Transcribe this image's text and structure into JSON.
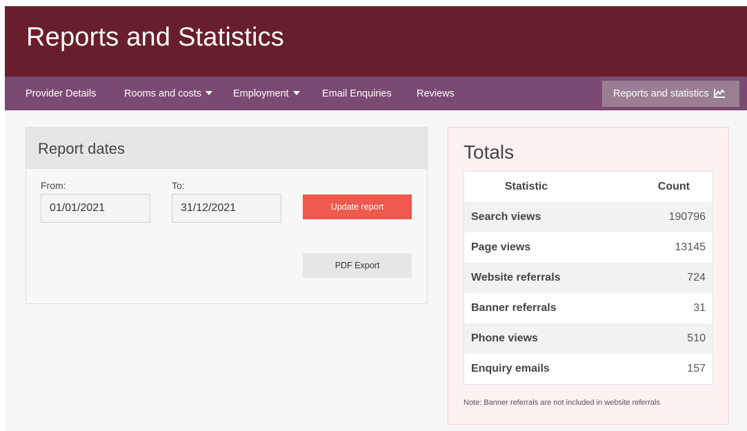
{
  "header": {
    "title": "Reports and Statistics"
  },
  "nav": {
    "provider_details": "Provider Details",
    "rooms_and_costs": "Rooms and costs",
    "employment": "Employment",
    "email_enquiries": "Email Enquiries",
    "reviews": "Reviews",
    "reports_and_statistics": "Reports and statistics"
  },
  "report_dates": {
    "heading": "Report dates",
    "from_label": "From:",
    "from_value": "01/01/2021",
    "to_label": "To:",
    "to_value": "31/12/2021",
    "update_button": "Update report",
    "pdf_button": "PDF Export"
  },
  "totals": {
    "title": "Totals",
    "columns": {
      "statistic": "Statistic",
      "count": "Count"
    },
    "rows": [
      {
        "label": "Search views",
        "count": "190796"
      },
      {
        "label": "Page views",
        "count": "13145"
      },
      {
        "label": "Website referrals",
        "count": "724"
      },
      {
        "label": "Banner referrals",
        "count": "31"
      },
      {
        "label": "Phone views",
        "count": "510"
      },
      {
        "label": "Enquiry emails",
        "count": "157"
      }
    ],
    "note": "Note: Banner referrals are not included in website referrals"
  },
  "colors": {
    "header_bg": "#691f2b",
    "nav_bg": "#7a4a72",
    "nav_active_bg": "#9a7f94",
    "update_button_bg": "#ef584c",
    "totals_bg": "#fdf1f1"
  },
  "icons": {
    "reports_nav": "line-chart-icon",
    "dropdown": "caret-down-icon"
  }
}
